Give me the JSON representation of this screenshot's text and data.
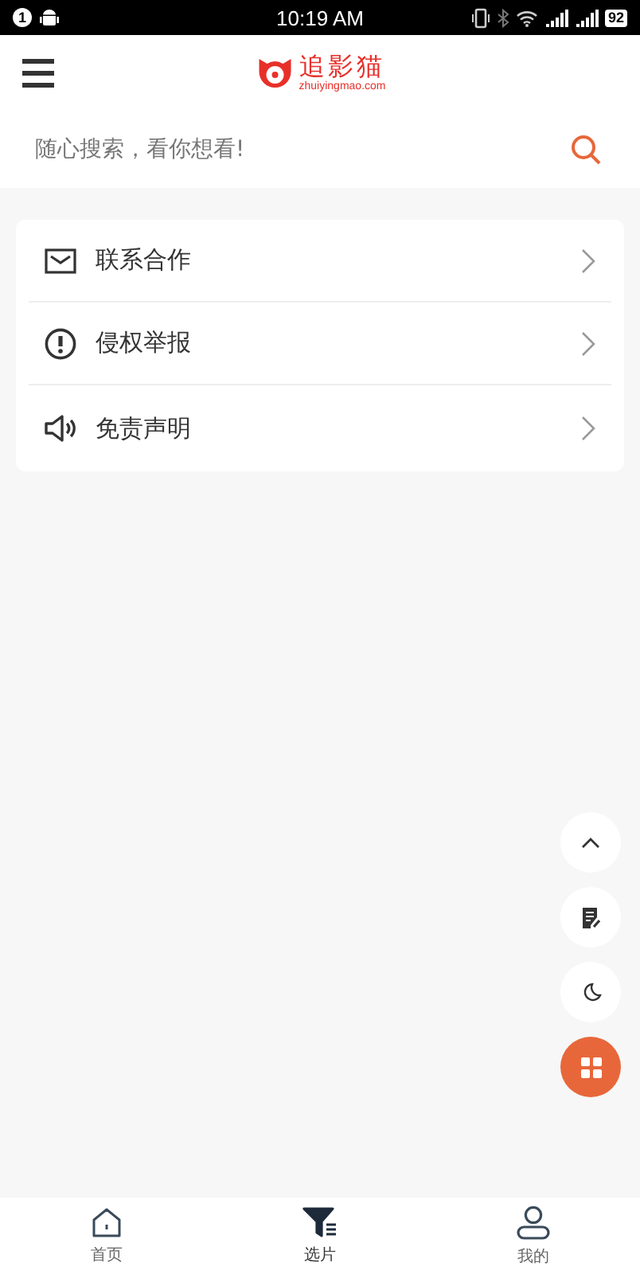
{
  "status_bar": {
    "notification_count": "1",
    "time": "10:19 AM",
    "battery": "92"
  },
  "header": {
    "logo_title": "追影猫",
    "logo_domain": "zhuiyingmao.com"
  },
  "search": {
    "placeholder": "随心搜索，看你想看!"
  },
  "menu_items": [
    {
      "kind": "mail",
      "label": "联系合作"
    },
    {
      "kind": "alert",
      "label": "侵权举报"
    },
    {
      "kind": "speaker",
      "label": "免责声明"
    }
  ],
  "floating_buttons": [
    {
      "kind": "up"
    },
    {
      "kind": "note"
    },
    {
      "kind": "moon"
    },
    {
      "kind": "apps"
    }
  ],
  "tab_bar": [
    {
      "kind": "home",
      "label": "首页",
      "selected": false
    },
    {
      "kind": "filter",
      "label": "选片",
      "selected": true
    },
    {
      "kind": "user",
      "label": "我的",
      "selected": false
    }
  ]
}
